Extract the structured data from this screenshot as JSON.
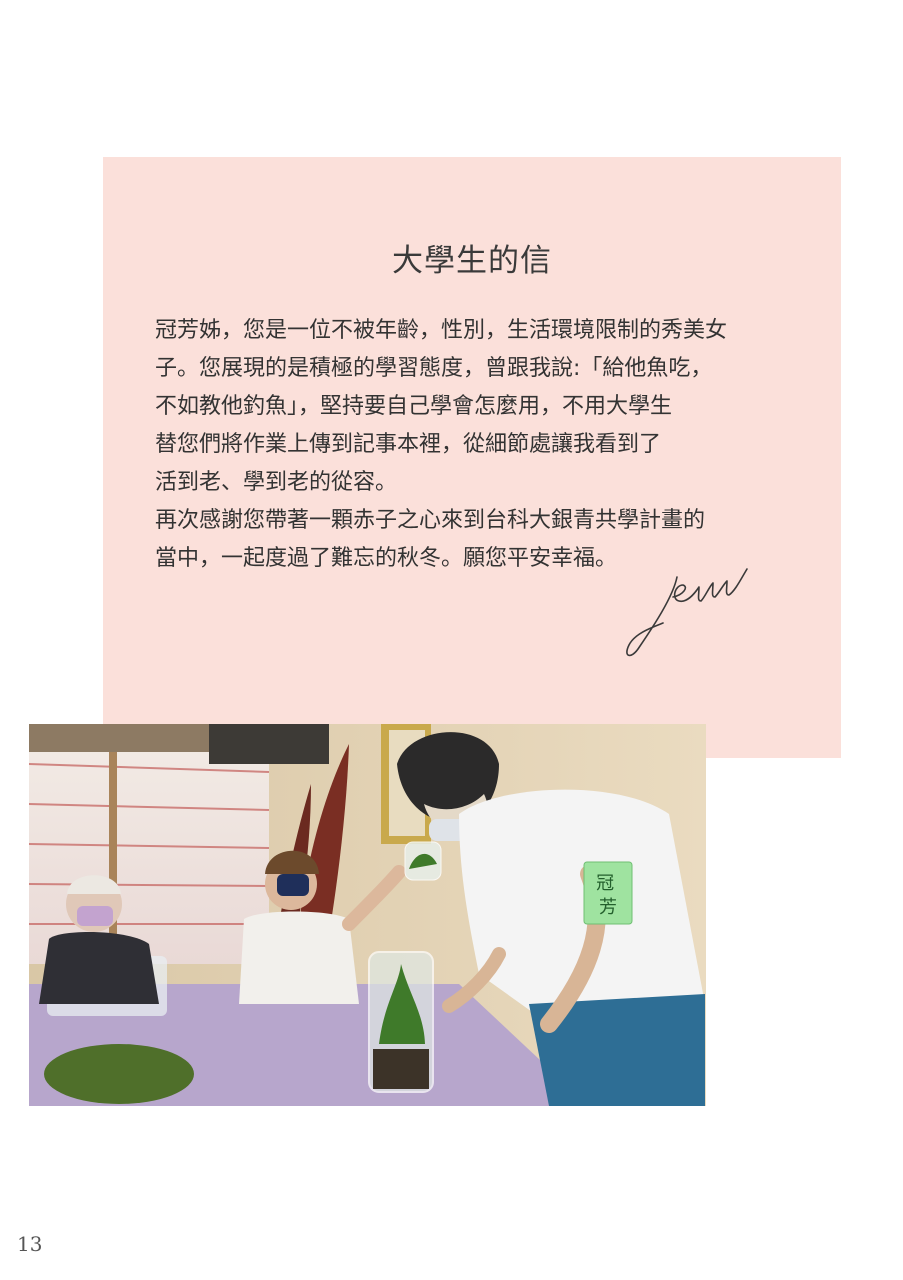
{
  "letter": {
    "title": "大學生的信",
    "lines": [
      "冠芳姊，您是一位不被年齡，性別，生活環境限制的秀美女",
      "子。您展現的是積極的學習態度，曾跟我說:「給他魚吃，",
      "不如教他釣魚」，堅持要自己學會怎麼用，不用大學生",
      "替您們將作業上傳到記事本裡，從細節處讓我看到了",
      "活到老、學到老的從容。",
      "再次感謝您帶著一顆赤子之心來到台科大銀青共學計畫的",
      "當中，一起度過了難忘的秋冬。願您平安幸福。"
    ],
    "signature": "Jenn",
    "background_color": "#fbe0da"
  },
  "photo": {
    "name_tag": "冠芳"
  },
  "page_number": "13"
}
